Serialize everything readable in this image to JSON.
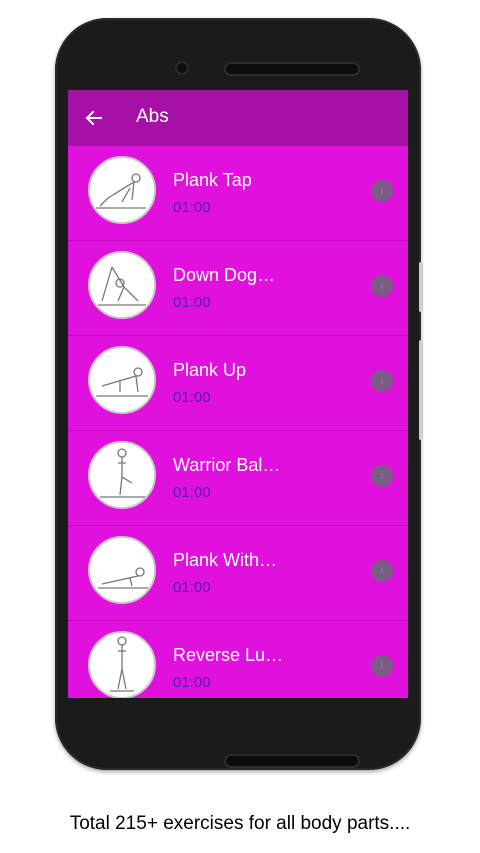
{
  "app_bar": {
    "title": "Abs"
  },
  "exercises": [
    {
      "name": "Plank Tap",
      "duration": "01:00"
    },
    {
      "name": "Down Dog…",
      "duration": "01:00"
    },
    {
      "name": "Plank Up",
      "duration": "01:00"
    },
    {
      "name": "Warrior Bal…",
      "duration": "01:00"
    },
    {
      "name": "Plank With…",
      "duration": "01:00"
    },
    {
      "name": "Reverse Lu…",
      "duration": "01:00"
    }
  ],
  "icons": {
    "back": "arrow-left-icon",
    "info": "info-icon"
  },
  "colors": {
    "screen": "#e010dd",
    "appbar": "#a710a6",
    "duration_text": "#4f1fb2"
  },
  "caption": "Total 215+ exercises for all body parts...."
}
